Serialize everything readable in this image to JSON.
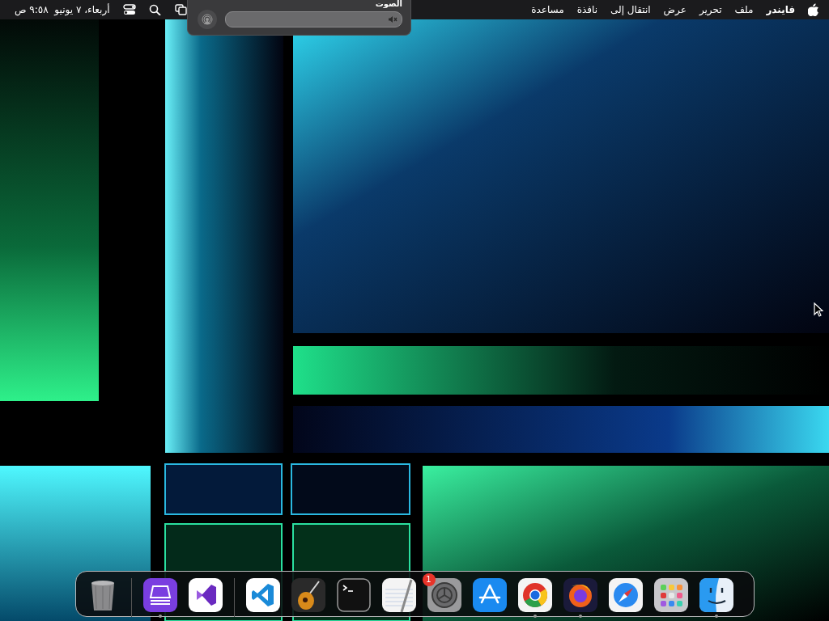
{
  "menu_bar": {
    "menus": [
      {
        "label": "فايندر",
        "app_name": true
      },
      {
        "label": "ملف",
        "app_name": false
      },
      {
        "label": "تحرير",
        "app_name": false
      },
      {
        "label": "عرض",
        "app_name": false
      },
      {
        "label": "انتقال إلى",
        "app_name": false
      },
      {
        "label": "نافذة",
        "app_name": false
      },
      {
        "label": "مساعدة",
        "app_name": false
      }
    ],
    "status_icons": [
      {
        "kind": "mirroring"
      },
      {
        "kind": "search"
      },
      {
        "kind": "control_center"
      }
    ],
    "clock": "أربعاء، ٧ يونيو  ٩:٥٨ ص"
  },
  "sound_popup": {
    "title": "الصوت",
    "volume": {
      "level": 0,
      "muted": true
    }
  },
  "dock": {
    "sections": [
      {
        "items": [
          {
            "kind": "trash",
            "running": false
          }
        ]
      },
      {
        "items": [
          {
            "kind": "configurator",
            "running": true
          },
          {
            "kind": "visual_studio",
            "running": false
          }
        ]
      },
      {
        "items": [
          {
            "kind": "vscode",
            "running": false
          },
          {
            "kind": "guitar",
            "running": false
          },
          {
            "kind": "terminal",
            "running": false
          },
          {
            "kind": "textedit",
            "running": false
          },
          {
            "kind": "settings",
            "running": false,
            "badge": "1"
          },
          {
            "kind": "appstore",
            "running": false
          },
          {
            "kind": "chrome",
            "running": true
          },
          {
            "kind": "firefox",
            "running": true
          },
          {
            "kind": "safari",
            "running": false
          },
          {
            "kind": "launchpad",
            "running": false
          },
          {
            "kind": "finder",
            "running": true
          }
        ]
      }
    ]
  }
}
